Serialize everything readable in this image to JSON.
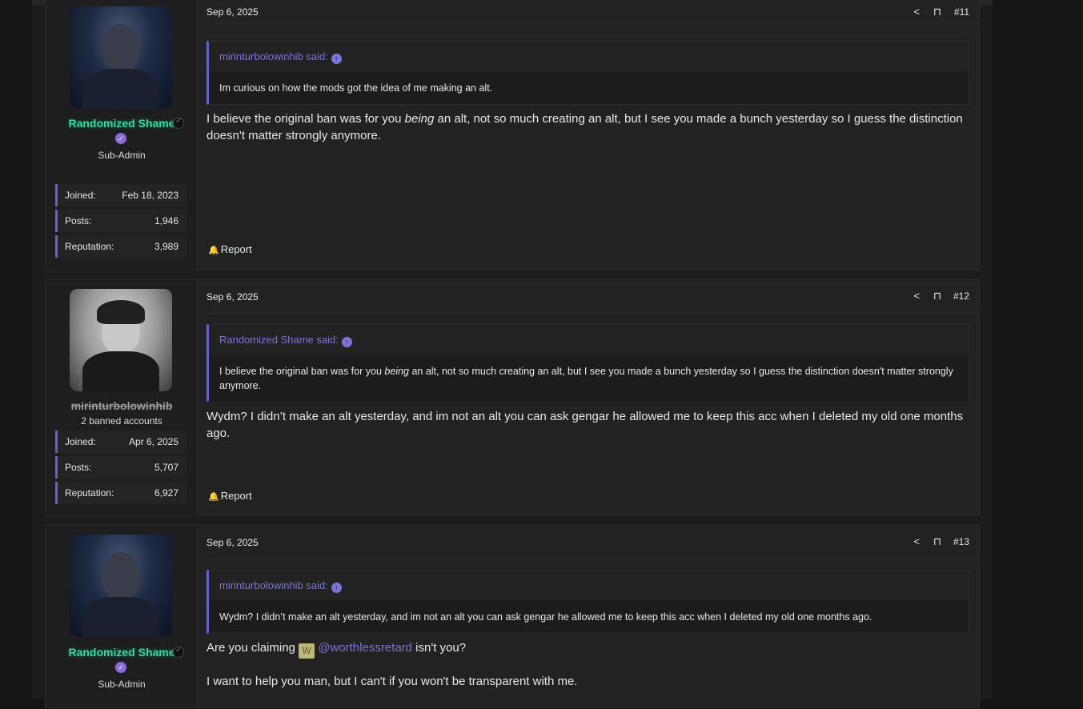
{
  "posts": [
    {
      "date": "Sep 6, 2025",
      "number": "#11",
      "user": {
        "name": "Randomized Shame",
        "title": "Sub-Admin",
        "stats": [
          {
            "label": "Joined:",
            "value": "Feb 18, 2023"
          },
          {
            "label": "Posts:",
            "value": "1,946"
          },
          {
            "label": "Reputation:",
            "value": "3,989"
          }
        ]
      },
      "quote": {
        "author": "mirinturbolowinhib said:",
        "text": "Im curious on how the mods got the idea of me making an alt."
      },
      "body": {
        "pre": "I believe the original ban was for you ",
        "em": "being",
        "post": " an alt, not so much creating an alt, but I see you made a bunch yesterday so I guess the distinction doesn't matter strongly anymore."
      },
      "report": "Report"
    },
    {
      "date": "Sep 6, 2025",
      "number": "#12",
      "user": {
        "name": "mirinturbolowinhib",
        "title": "2 banned accounts",
        "stats": [
          {
            "label": "Joined:",
            "value": "Apr 6, 2025"
          },
          {
            "label": "Posts:",
            "value": "5,707"
          },
          {
            "label": "Reputation:",
            "value": "6,927"
          }
        ]
      },
      "quote": {
        "author": "Randomized Shame said:",
        "pre": "I believe the original ban was for you ",
        "em": "being",
        "post": " an alt, not so much creating an alt, but I see you made a bunch yesterday so I guess the distinction doesn't matter strongly anymore."
      },
      "body": "Wydm? I didn’t make an alt yesterday, and im not an alt you can ask gengar he allowed me to keep this acc when I deleted my old one months ago.",
      "report": "Report"
    },
    {
      "date": "Sep 6, 2025",
      "number": "#13",
      "user": {
        "name": "Randomized Shame",
        "title": "Sub-Admin"
      },
      "quote": {
        "author": "mirinturbolowinhib said:",
        "text": "Wydm? I didn’t make an alt yesterday, and im not an alt you can ask gengar he allowed me to keep this acc when I deleted my old one months ago."
      },
      "body1_pre": "Are you claiming ",
      "mention_badge": "W",
      "mention": "@worthlessretard",
      "body1_post": " isn't you?",
      "body2": "I want to help you man, but I can't if you won't be transparent with me."
    }
  ],
  "colors": {
    "accent": "#6a5fd0",
    "username_green": "#3dd6a0",
    "link": "#7b75d6"
  },
  "icons": {
    "share": "share-icon",
    "bookmark": "bookmark-icon",
    "bell": "bell-icon",
    "quote_up": "arrow-up-circle-icon"
  }
}
